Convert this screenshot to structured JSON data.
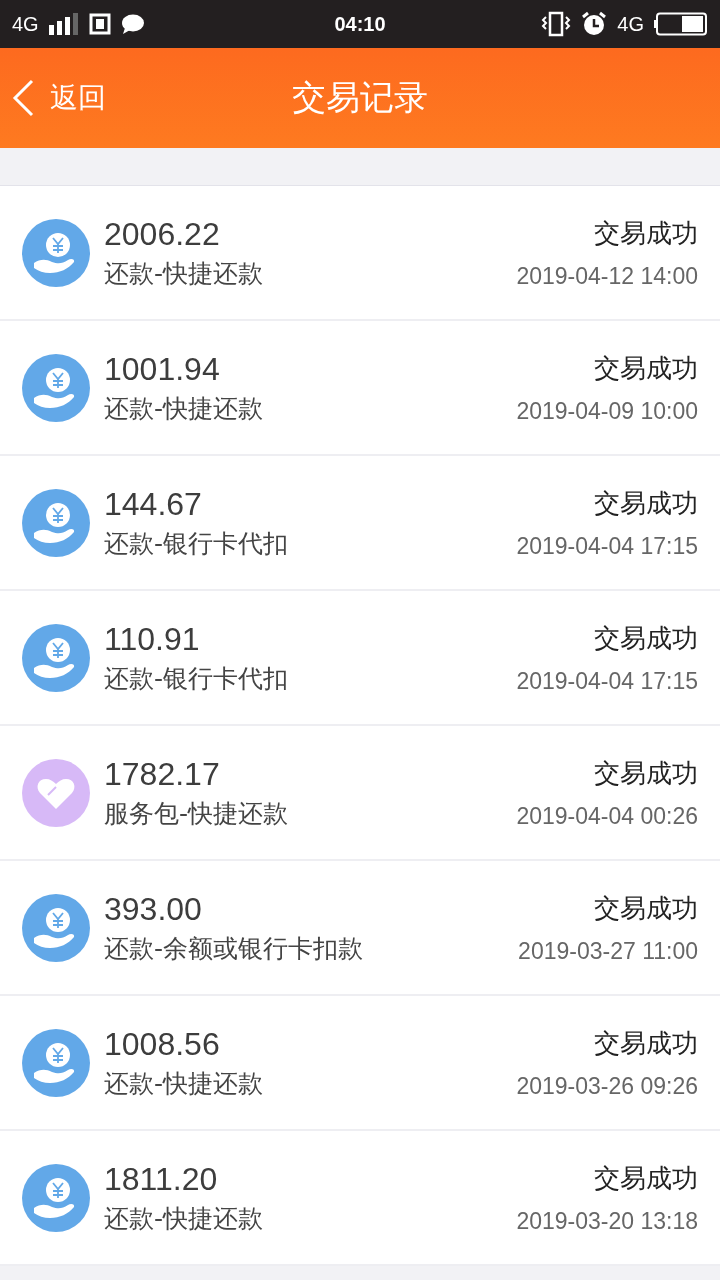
{
  "status_bar": {
    "network": "4G",
    "time": "04:10",
    "network_right": "4G"
  },
  "header": {
    "back": "返回",
    "title": "交易记录"
  },
  "transactions": [
    {
      "kind": "repay",
      "amount": "2006.22",
      "desc": "还款-快捷还款",
      "status": "交易成功",
      "date": "2019-04-12 14:00"
    },
    {
      "kind": "repay",
      "amount": "1001.94",
      "desc": "还款-快捷还款",
      "status": "交易成功",
      "date": "2019-04-09 10:00"
    },
    {
      "kind": "repay",
      "amount": "144.67",
      "desc": "还款-银行卡代扣",
      "status": "交易成功",
      "date": "2019-04-04 17:15"
    },
    {
      "kind": "repay",
      "amount": "110.91",
      "desc": "还款-银行卡代扣",
      "status": "交易成功",
      "date": "2019-04-04 17:15"
    },
    {
      "kind": "service",
      "amount": "1782.17",
      "desc": "服务包-快捷还款",
      "status": "交易成功",
      "date": "2019-04-04 00:26"
    },
    {
      "kind": "repay",
      "amount": "393.00",
      "desc": "还款-余额或银行卡扣款",
      "status": "交易成功",
      "date": "2019-03-27 11:00"
    },
    {
      "kind": "repay",
      "amount": "1008.56",
      "desc": "还款-快捷还款",
      "status": "交易成功",
      "date": "2019-03-26 09:26"
    },
    {
      "kind": "repay",
      "amount": "1811.20",
      "desc": "还款-快捷还款",
      "status": "交易成功",
      "date": "2019-03-20 13:18"
    }
  ]
}
